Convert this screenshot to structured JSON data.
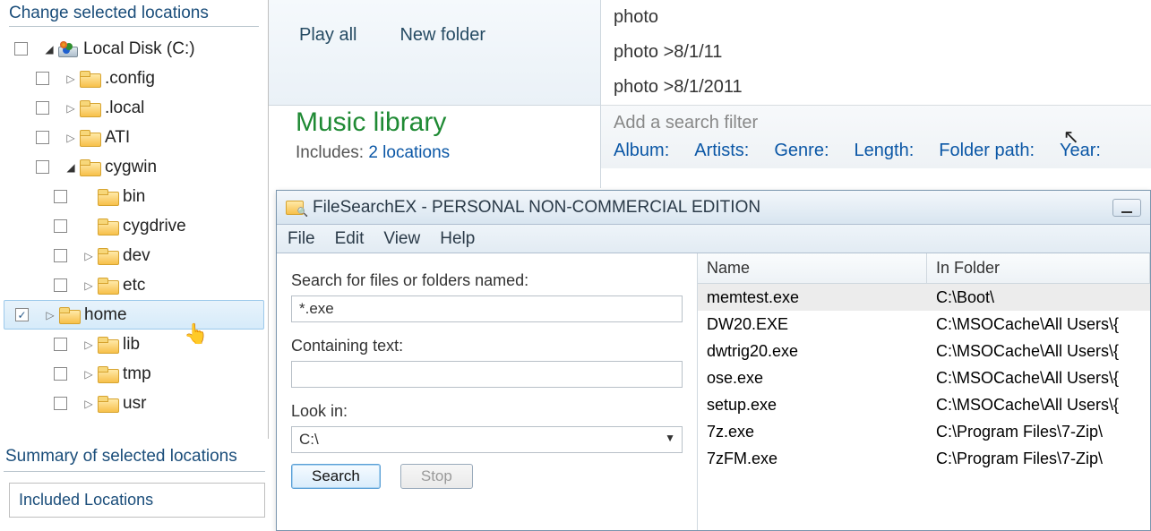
{
  "tree": {
    "header": "Change selected locations",
    "root": {
      "label": "Local Disk (C:)",
      "expanded": true
    },
    "items": [
      {
        "label": ".config",
        "checked": false,
        "arrow": "closed",
        "depth": 1
      },
      {
        "label": ".local",
        "checked": false,
        "arrow": "closed",
        "depth": 1
      },
      {
        "label": "ATI",
        "checked": false,
        "arrow": "closed",
        "depth": 1
      },
      {
        "label": "cygwin",
        "checked": false,
        "arrow": "open",
        "depth": 1
      },
      {
        "label": "bin",
        "checked": false,
        "arrow": "none",
        "depth": 2
      },
      {
        "label": "cygdrive",
        "checked": false,
        "arrow": "none",
        "depth": 2
      },
      {
        "label": "dev",
        "checked": false,
        "arrow": "closed",
        "depth": 2
      },
      {
        "label": "etc",
        "checked": false,
        "arrow": "closed",
        "depth": 2
      },
      {
        "label": "home",
        "checked": true,
        "arrow": "closed",
        "depth": 2,
        "selected": true
      },
      {
        "label": "lib",
        "checked": false,
        "arrow": "closed",
        "depth": 2
      },
      {
        "label": "tmp",
        "checked": false,
        "arrow": "closed",
        "depth": 2
      },
      {
        "label": "usr",
        "checked": false,
        "arrow": "closed",
        "depth": 2
      }
    ]
  },
  "summary": {
    "header": "Summary of selected locations",
    "included_label": "Included Locations"
  },
  "explorer": {
    "play_all": "Play all",
    "new_folder": "New folder",
    "library_title": "Music library",
    "includes_label": "Includes:",
    "includes_link": "2 locations"
  },
  "search": {
    "suggestions": [
      "photo",
      "photo >8/1/11",
      "photo >8/1/2011"
    ],
    "filter_hint": "Add a search filter",
    "filters": [
      "Album:",
      "Artists:",
      "Genre:",
      "Length:",
      "Folder path:",
      "Year:"
    ]
  },
  "fsex": {
    "title": "FileSearchEX - PERSONAL NON-COMMERCIAL EDITION",
    "menu": [
      "File",
      "Edit",
      "View",
      "Help"
    ],
    "labels": {
      "search_for": "Search for files or folders named:",
      "containing": "Containing text:",
      "look_in": "Look in:"
    },
    "inputs": {
      "pattern": "*.exe",
      "containing": "",
      "look_in": "C:\\"
    },
    "buttons": {
      "search": "Search",
      "stop": "Stop"
    },
    "columns": {
      "name": "Name",
      "folder": "In Folder"
    },
    "rows": [
      {
        "name": "memtest.exe",
        "folder": "C:\\Boot\\",
        "selected": true
      },
      {
        "name": "DW20.EXE",
        "folder": "C:\\MSOCache\\All Users\\{"
      },
      {
        "name": "dwtrig20.exe",
        "folder": "C:\\MSOCache\\All Users\\{"
      },
      {
        "name": "ose.exe",
        "folder": "C:\\MSOCache\\All Users\\{"
      },
      {
        "name": "setup.exe",
        "folder": "C:\\MSOCache\\All Users\\{"
      },
      {
        "name": "7z.exe",
        "folder": "C:\\Program Files\\7-Zip\\"
      },
      {
        "name": "7zFM.exe",
        "folder": "C:\\Program Files\\7-Zip\\"
      }
    ]
  }
}
